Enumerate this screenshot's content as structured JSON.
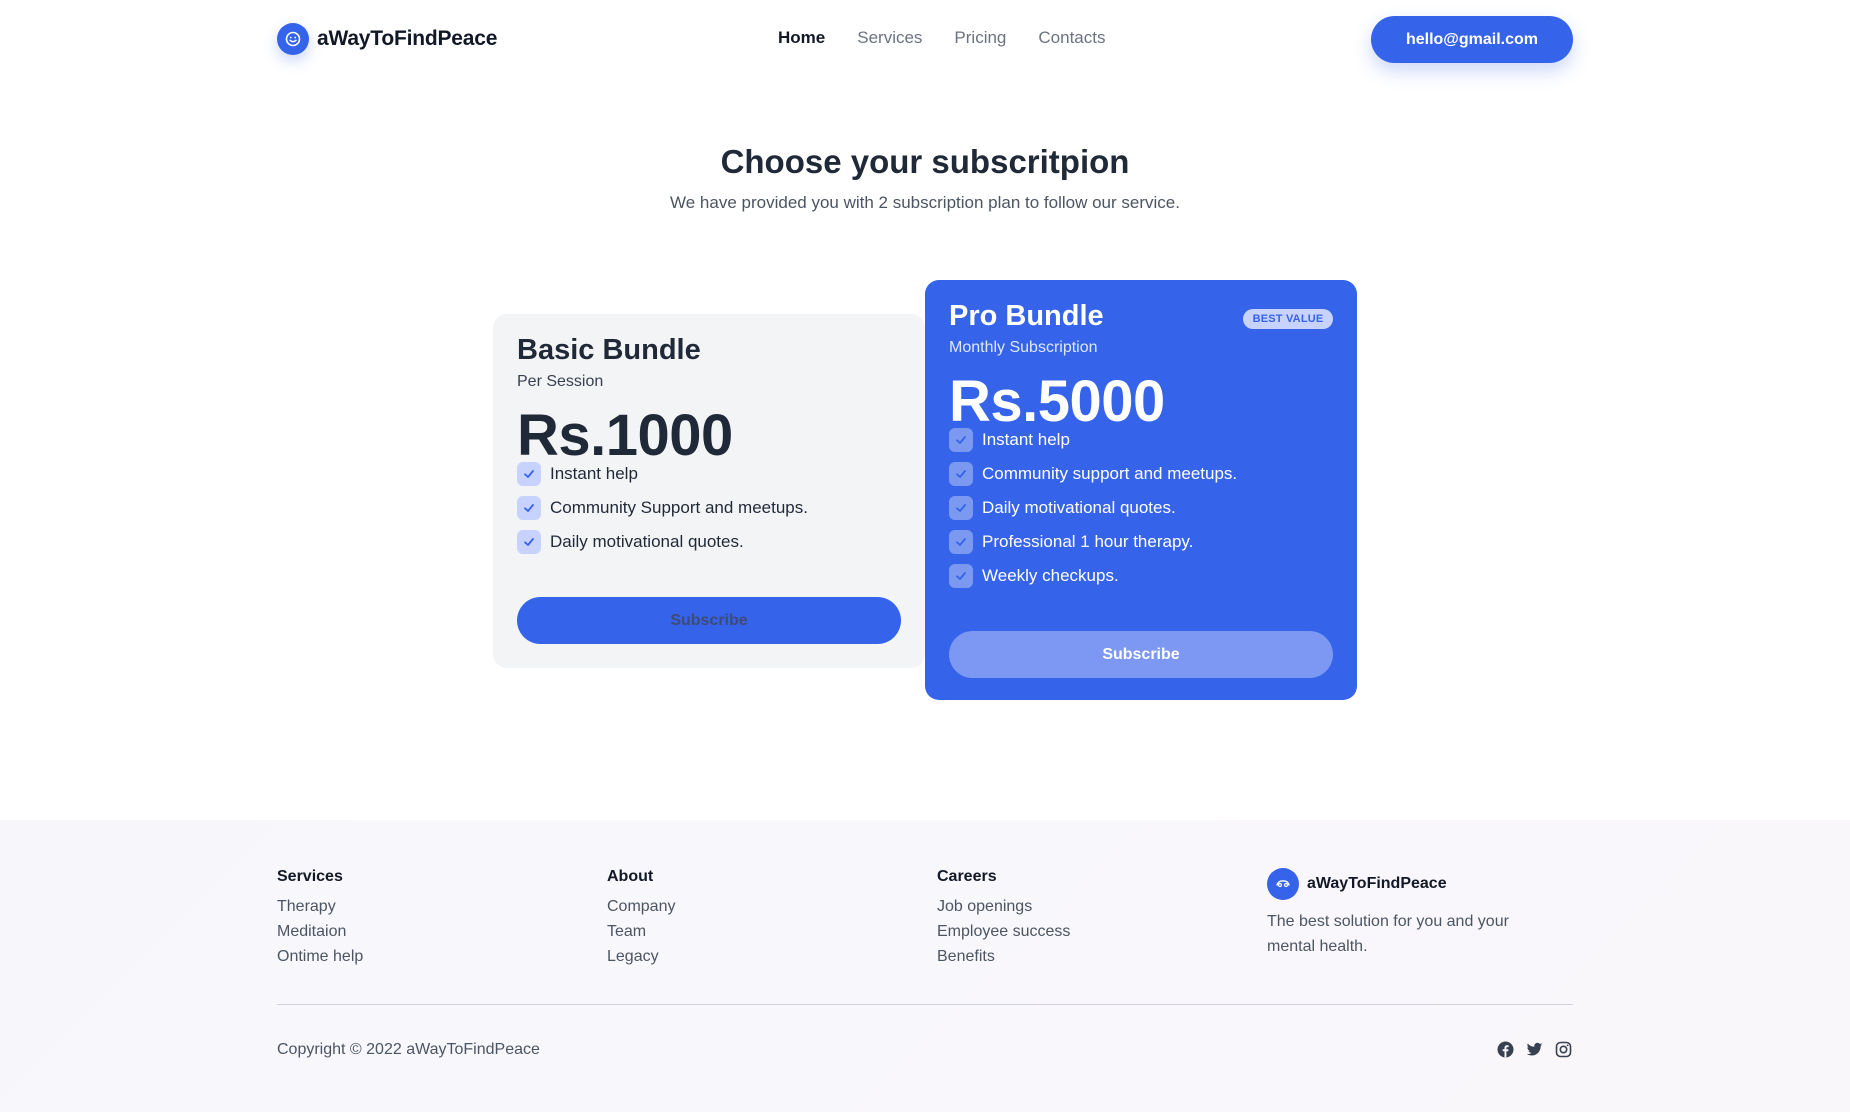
{
  "header": {
    "brand_name": "aWayToFindPeace",
    "logo_icon": "smiley-icon",
    "nav": [
      "Home",
      "Services",
      "Pricing",
      "Contacts"
    ],
    "active_nav": "Home",
    "email_button": "hello@gmail.com"
  },
  "main": {
    "title": "Choose your subscritpion",
    "subtitle": "We have provided you with 2 subscription plan to follow our service."
  },
  "plans": [
    {
      "name": "Basic Bundle",
      "period": "Per Session",
      "price": "Rs.1000",
      "features": [
        "Instant help",
        "Community Support and meetups.",
        "Daily motivational quotes."
      ],
      "button": "Subscribe"
    },
    {
      "name": "Pro Bundle",
      "period": "Monthly Subscription",
      "price": "Rs.5000",
      "badge": "BEST VALUE",
      "features": [
        "Instant help",
        "Community support and meetups.",
        "Daily motivational quotes.",
        "Professional 1 hour therapy.",
        "Weekly checkups."
      ],
      "button": "Subscribe"
    }
  ],
  "footer": {
    "columns": [
      {
        "heading": "Services",
        "links": [
          "Therapy",
          "Meditaion",
          "Ontime help"
        ]
      },
      {
        "heading": "About",
        "links": [
          "Company",
          "Team",
          "Legacy"
        ]
      },
      {
        "heading": "Careers",
        "links": [
          "Job openings",
          "Employee success",
          "Benefits"
        ]
      }
    ],
    "brand_name": "aWayToFindPeace",
    "tagline": "The best solution for you and your mental health.",
    "copyright": "Copyright © 2022 aWayToFindPeace",
    "socials": [
      "facebook-icon",
      "twitter-icon",
      "instagram-icon"
    ]
  },
  "colors": {
    "accent": "#3563e9",
    "pro_button": "#7c98f2",
    "badge_bg": "#c7d2fe",
    "basic_card_bg": "#f3f4f6"
  }
}
